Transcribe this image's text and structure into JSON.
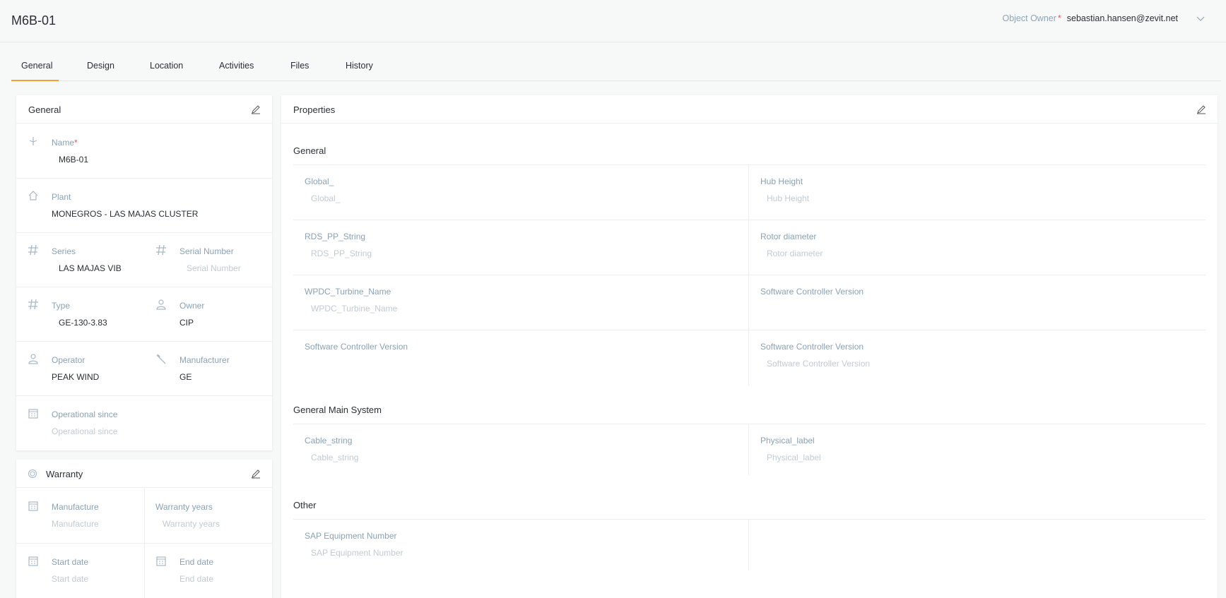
{
  "header": {
    "title": "M6B-01",
    "owner_label": "Object Owner",
    "owner_required": "*",
    "owner_value": "sebastian.hansen@zevit.net"
  },
  "tabs": [
    {
      "label": "General",
      "active": true
    },
    {
      "label": "Design"
    },
    {
      "label": "Location"
    },
    {
      "label": "Activities"
    },
    {
      "label": "Files"
    },
    {
      "label": "History"
    }
  ],
  "general_card": {
    "title": "General",
    "name": {
      "label": "Name",
      "required": "*",
      "value": "M6B-01"
    },
    "plant": {
      "label": "Plant",
      "value": "MONEGROS - LAS MAJAS CLUSTER"
    },
    "series": {
      "label": "Series",
      "value": "LAS MAJAS VIB"
    },
    "serial_number": {
      "label": "Serial Number",
      "placeholder": "Serial Number"
    },
    "type": {
      "label": "Type",
      "value": "GE-130-3.83"
    },
    "owner": {
      "label": "Owner",
      "value": "CIP"
    },
    "operator": {
      "label": "Operator",
      "value": "PEAK WIND"
    },
    "manufacturer": {
      "label": "Manufacturer",
      "value": "GE"
    },
    "operational_since": {
      "label": "Operational since",
      "placeholder": "Operational since"
    }
  },
  "warranty_card": {
    "title": "Warranty",
    "manufacture": {
      "label": "Manufacture",
      "placeholder": "Manufacture"
    },
    "warranty_years": {
      "label": "Warranty years",
      "placeholder": "Warranty years"
    },
    "start_date": {
      "label": "Start date",
      "placeholder": "Start date"
    },
    "end_date": {
      "label": "End date",
      "placeholder": "End date"
    }
  },
  "properties_card": {
    "title": "Properties",
    "sections": [
      {
        "title": "General",
        "fields": [
          {
            "label": "Global_",
            "placeholder": "Global_"
          },
          {
            "label": "Hub Height",
            "placeholder": "Hub Height"
          },
          {
            "label": "RDS_PP_String",
            "placeholder": "RDS_PP_String"
          },
          {
            "label": "Rotor diameter",
            "placeholder": "Rotor diameter"
          },
          {
            "label": "WPDC_Turbine_Name",
            "placeholder": "WPDC_Turbine_Name"
          },
          {
            "label": "Software Controller Version",
            "placeholder": ""
          },
          {
            "label": "Software Controller Version",
            "placeholder": ""
          },
          {
            "label": "Software Controller Version",
            "placeholder": "Software Controller Version"
          }
        ]
      },
      {
        "title": "General Main System",
        "fields": [
          {
            "label": "Cable_string",
            "placeholder": "Cable_string"
          },
          {
            "label": "Physical_label",
            "placeholder": "Physical_label"
          }
        ]
      },
      {
        "title": "Other",
        "fields": [
          {
            "label": "SAP Equipment Number",
            "placeholder": "SAP Equipment Number"
          }
        ]
      }
    ]
  },
  "colors": {
    "accent": "#f0a133",
    "label": "#8aa2b4",
    "placeholder": "#c2cbd2",
    "required": "#e05a5a"
  }
}
